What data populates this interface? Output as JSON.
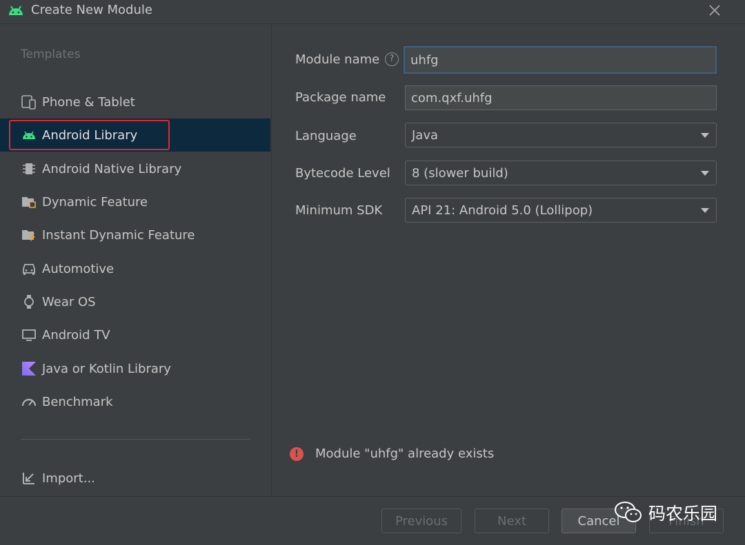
{
  "window": {
    "title": "Create New Module"
  },
  "sidebar": {
    "heading": "Templates",
    "items": [
      {
        "label": "Phone & Tablet",
        "icon": "phone-tablet-icon"
      },
      {
        "label": "Android Library",
        "icon": "android-icon",
        "selected": true
      },
      {
        "label": "Android Native Library",
        "icon": "chip-icon"
      },
      {
        "label": "Dynamic Feature",
        "icon": "folder-feature-icon"
      },
      {
        "label": "Instant Dynamic Feature",
        "icon": "folder-lightning-icon"
      },
      {
        "label": "Automotive",
        "icon": "car-icon"
      },
      {
        "label": "Wear OS",
        "icon": "watch-icon"
      },
      {
        "label": "Android TV",
        "icon": "tv-icon"
      },
      {
        "label": "Java or Kotlin Library",
        "icon": "kotlin-icon"
      },
      {
        "label": "Benchmark",
        "icon": "gauge-icon"
      }
    ],
    "import_label": "Import..."
  },
  "form": {
    "module_name": {
      "label": "Module name",
      "value": "uhfg"
    },
    "package_name": {
      "label": "Package name",
      "value": "com.qxf.uhfg"
    },
    "language": {
      "label": "Language",
      "value": "Java"
    },
    "bytecode_level": {
      "label": "Bytecode Level",
      "value": "8 (slower build)"
    },
    "minimum_sdk": {
      "label": "Minimum SDK",
      "value": "API 21: Android 5.0 (Lollipop)"
    }
  },
  "error": {
    "message": "Module \"uhfg\" already exists"
  },
  "footer": {
    "previous_label": "Previous",
    "next_label": "Next",
    "cancel_label": "Cancel",
    "finish_label": "Finish"
  },
  "watermark": {
    "text": "码农乐园"
  },
  "colors": {
    "selection": "#0d293e",
    "highlight": "#e0282f",
    "android_green": "#3ddc84",
    "error": "#d9534f"
  }
}
